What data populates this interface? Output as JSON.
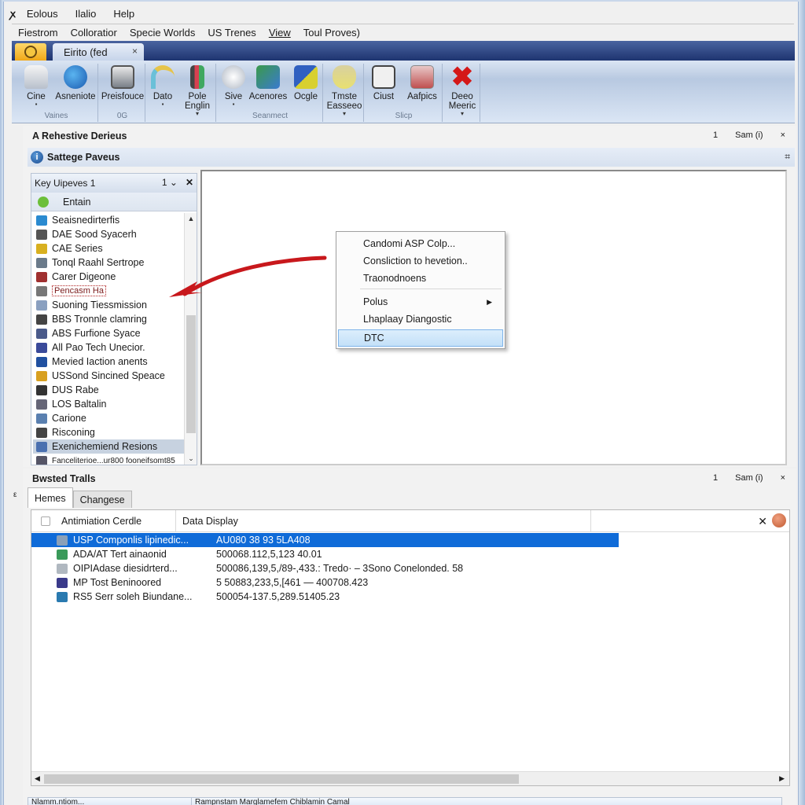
{
  "menus": {
    "row1": [
      "Eolous",
      "Ilalio",
      "Help"
    ],
    "row2": [
      "Fiestrom",
      "Colloratior",
      "Specie Worlds",
      "US Trenes",
      "View",
      "Toul Proves)"
    ]
  },
  "doc_tab": {
    "label": "Eirito (fed",
    "close": "×"
  },
  "ribbon": {
    "groups": [
      {
        "label": "Vaines",
        "buttons": [
          "Cine",
          "Asneniote"
        ]
      },
      {
        "label": "0G",
        "buttons": [
          "Preisfouce"
        ]
      },
      {
        "label": "",
        "buttons": [
          "Dato",
          "Pole Englin"
        ]
      },
      {
        "label": "Seanmect",
        "buttons": [
          "Sive",
          "Acenores",
          "Ocgle"
        ]
      },
      {
        "label": "",
        "buttons": [
          "Tmste Easseeo"
        ]
      },
      {
        "label": "Slicp",
        "buttons": [
          "Ciust",
          "Aafpics"
        ]
      },
      {
        "label": "",
        "buttons": [
          "Deeo Meeric"
        ]
      }
    ]
  },
  "top_section": {
    "title": "A Rehestive Derieus",
    "right_num": "1",
    "right_label": "Sam (i)",
    "close": "×",
    "sub_title": "Sattege Paveus",
    "pin": "⌗"
  },
  "key_panel": {
    "title": "Key Uipeves 1",
    "count": "1",
    "close": "✕",
    "entry": "Entain",
    "items": [
      "Seaisnedirterfis",
      "DAE Sood Syacerh",
      "CAE Series",
      "Tonql Raahl Sertrope",
      "Carer Digeone",
      "Pencasm Ha",
      "Suoning Tiessmission",
      "BBS Tronnle clamring",
      "ABS Furfione Syace",
      "All Pao Tech Unecior.",
      "Mevied Iaction anents",
      "USSond Sincined Speace",
      "DUS Rabe",
      "LOS Baltalin",
      "Carione",
      "Risconing",
      "Exenichemiend Resions",
      "Fanceliterioe...ur800 fooneifsomt85"
    ],
    "selected_index": 16,
    "boxed_index": 5
  },
  "context_menu": {
    "items": [
      {
        "label": "Candomi ASP Colp...",
        "submenu": false
      },
      {
        "label": "Consliction to hevetion..",
        "submenu": false
      },
      {
        "label": "Traonodnoens",
        "submenu": false
      },
      {
        "label": "Polus",
        "submenu": true
      },
      {
        "label": "Lhaplaay Diangostic",
        "submenu": false
      },
      {
        "label": "DTC",
        "submenu": false,
        "highlighted": true
      }
    ]
  },
  "bottom_section": {
    "title": "Bwsted Tralls",
    "right_num": "1",
    "right_label": "Sam (i)",
    "close": "×",
    "tabs": [
      "Hemes",
      "Changese"
    ],
    "columns": [
      "Antimiation Cerdle",
      "Data Display"
    ],
    "rows": [
      {
        "name": "USP Componlis lipinedic...",
        "value": "AU080 38 93 5LA408",
        "selected": true
      },
      {
        "name": "ADA/AT Tert ainaonid",
        "value": "500068.112,5,123 40.01"
      },
      {
        "name": "OIPIAdase diesidrterd...",
        "value": "500086,139,5,/89-,433.: Tredo· – 3Sono Conelonded. 58"
      },
      {
        "name": "MP Tost Beninoored",
        "value": "5 50883,233,5,[461 — 400708.423"
      },
      {
        "name": "RS5 Serr soleh Biundane...",
        "value": "500054-137.5,289.51405.23"
      }
    ],
    "status": [
      "Nlamm.ntiom...",
      "Rampnstam Marglamefem Chiblamin Camal"
    ]
  },
  "colors": {
    "selection": "#0f6bd8",
    "tab_strip": "#1e3470",
    "arrow": "#c8181c"
  }
}
